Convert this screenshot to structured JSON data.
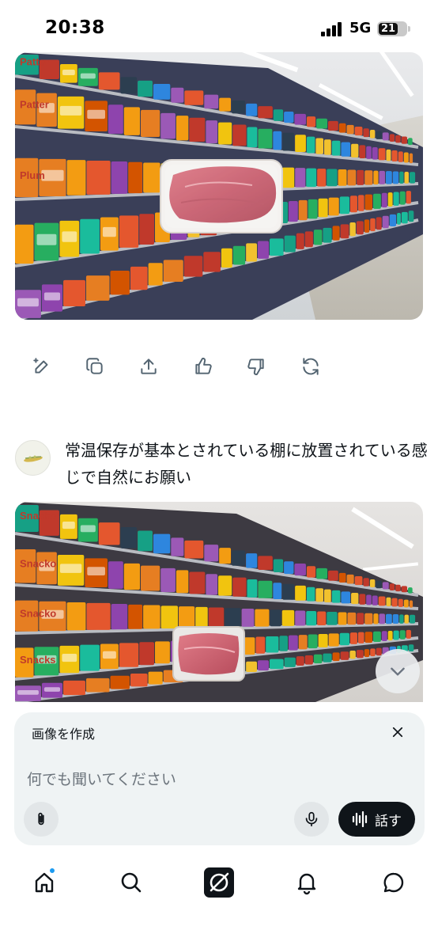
{
  "status_bar": {
    "time": "20:38",
    "network": "5G",
    "battery": "21"
  },
  "conversation": {
    "image_1": {
      "alt": "meat-package-on-snack-shelf"
    },
    "actions": [
      {
        "icon": "edit-sparkle-icon"
      },
      {
        "icon": "copy-icon"
      },
      {
        "icon": "share-icon"
      },
      {
        "icon": "thumbs-up-icon"
      },
      {
        "icon": "thumbs-down-icon"
      },
      {
        "icon": "regenerate-icon"
      }
    ],
    "user_prompt": "常温保存が基本とされている棚に放置されている感じで自然にお願い",
    "image_2": {
      "alt": "meat-package-on-snack-shelf"
    }
  },
  "image_labels": {
    "img1": [
      "Patter",
      "Patter",
      "Plum"
    ],
    "img2": [
      "Snacko",
      "Snacko",
      "Snacko",
      "Snacks"
    ]
  },
  "composer": {
    "mode_title": "画像を作成",
    "placeholder": "何でも聞いてください",
    "talk_label": "話す"
  },
  "nav": [
    {
      "icon": "home-icon",
      "has_badge": true
    },
    {
      "icon": "search-icon"
    },
    {
      "icon": "grok-icon"
    },
    {
      "icon": "notifications-icon"
    },
    {
      "icon": "messages-icon"
    }
  ],
  "colors": {
    "accent": "#1d9bf0",
    "text": "#0f1419",
    "muted": "#536471",
    "composer_bg": "#eff3f4"
  }
}
